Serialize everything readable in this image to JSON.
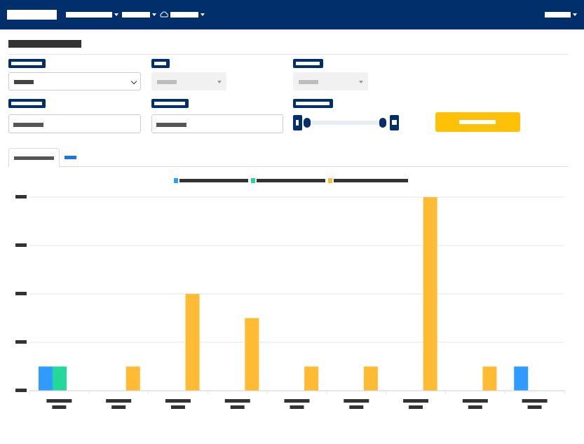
{
  "navbar": {
    "brand": "",
    "menu_1": "",
    "menu_2": "",
    "menu_3": "",
    "user_menu": ""
  },
  "page": {
    "title": ""
  },
  "filters": {
    "label_1": "",
    "label_2": "",
    "label_3": "",
    "label_4": "",
    "label_5": "",
    "label_6": "",
    "select_1_value": "",
    "select_2_value": "",
    "select_3_value": "",
    "input_1_value": "",
    "input_2_value": "",
    "apply_label": ""
  },
  "tabs": [
    {
      "label": ""
    },
    {
      "label": ""
    }
  ],
  "colors": {
    "nav": "#002f6c",
    "series_1": "#2f9bff",
    "series_2": "#22d89a",
    "series_3": "#ffbb33",
    "apply": "#ffc107"
  },
  "chart_data": {
    "type": "bar",
    "categories": [
      "",
      "",
      "",
      "",
      "",
      "",
      "",
      "",
      ""
    ],
    "ylim": [
      0,
      8
    ],
    "yticks": [
      0,
      2,
      4,
      6,
      8
    ],
    "ytick_labels": [
      "",
      "",
      "",
      "",
      ""
    ],
    "grid": true,
    "legend_position": "top-center",
    "series": [
      {
        "color": "#2f9bff",
        "values": [
          1,
          0,
          0,
          0,
          0,
          0,
          0,
          0,
          1
        ]
      },
      {
        "color": "#22d89a",
        "values": [
          1,
          0,
          0,
          0,
          0,
          0,
          0,
          0,
          0
        ]
      },
      {
        "color": "#ffbb33",
        "values": [
          0,
          1,
          4,
          3,
          1,
          1,
          8,
          1,
          0
        ]
      }
    ]
  }
}
